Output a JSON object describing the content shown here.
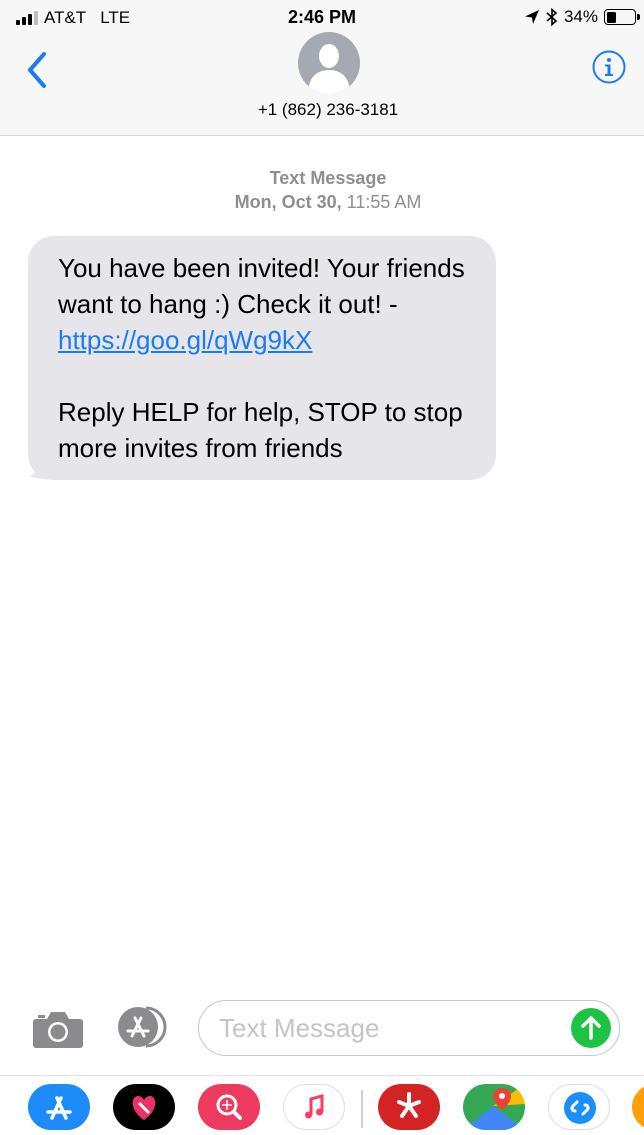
{
  "status_bar": {
    "carrier": "AT&T",
    "network": "LTE",
    "time": "2:46 PM",
    "battery_percent": "34%",
    "battery_level": 0.34,
    "icons": [
      "signal-bars-icon",
      "location-arrow-icon",
      "bluetooth-icon",
      "battery-icon"
    ]
  },
  "header": {
    "contact": "+1 (862) 236-3181",
    "icons": [
      "chevron-left-icon",
      "contact-avatar-icon",
      "info-icon"
    ]
  },
  "conversation": {
    "service": "Text Message",
    "date_bold": "Mon, Oct 30,",
    "time": " 11:55 AM",
    "message": {
      "text_before_link": "You have been invited! Your friends want to hang :) Check it out! - ",
      "link": "https://goo.gl/qWg9kX",
      "second_paragraph": "Reply HELP for help, STOP to stop more invites from friends"
    }
  },
  "composer": {
    "placeholder": "Text Message",
    "icons": [
      "camera-icon",
      "app-store-icon",
      "send-arrow-icon"
    ]
  },
  "app_drawer": {
    "apps": [
      "app-store-icon",
      "digital-touch-heart-icon",
      "images-search-icon",
      "music-icon",
      "yelp-icon",
      "google-maps-icon",
      "shazam-icon",
      "partial-app-icon"
    ]
  },
  "colors": {
    "accent": "#1a7cf2",
    "bubble_gray": "#e5e5ea",
    "send_green": "#1ec343",
    "secondary_text": "#8e8e93"
  }
}
